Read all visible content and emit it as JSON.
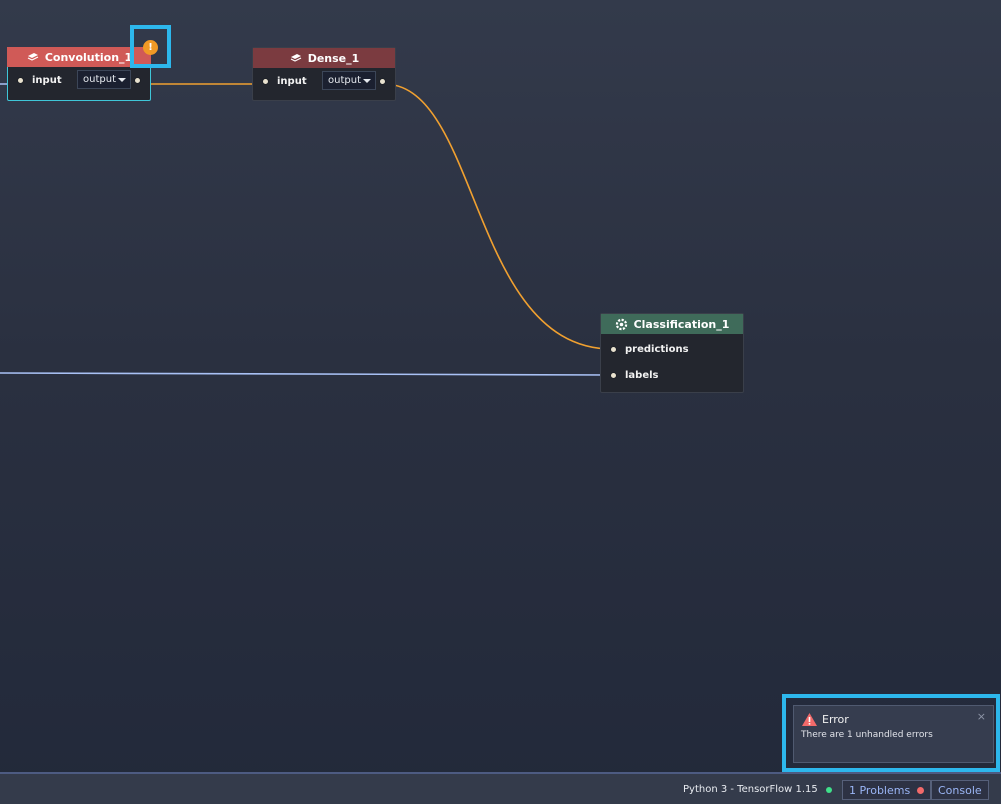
{
  "colors": {
    "wire_orange": "#f0a030",
    "wire_blue": "#a9c1f5",
    "highlight": "#2db7ec",
    "warning": "#f19a26",
    "error": "#f26a6a",
    "ok": "#3fe08a"
  },
  "nodes": {
    "convolution": {
      "title": "Convolution_1",
      "icon": "layer-icon",
      "input_label": "input",
      "output_value": "output"
    },
    "dense": {
      "title": "Dense_1",
      "icon": "layer-icon",
      "input_label": "input",
      "output_value": "output"
    },
    "classification": {
      "title": "Classification_1",
      "icon": "gear-icon",
      "inputs": [
        "predictions",
        "labels"
      ]
    }
  },
  "warning_badge": {
    "symbol": "!"
  },
  "toast": {
    "title": "Error",
    "message": "There are 1 unhandled errors",
    "close": "×"
  },
  "statusbar": {
    "runtime": "Python 3 - TensorFlow 1.15",
    "problems_label": "1 Problems",
    "console_label": "Console"
  }
}
